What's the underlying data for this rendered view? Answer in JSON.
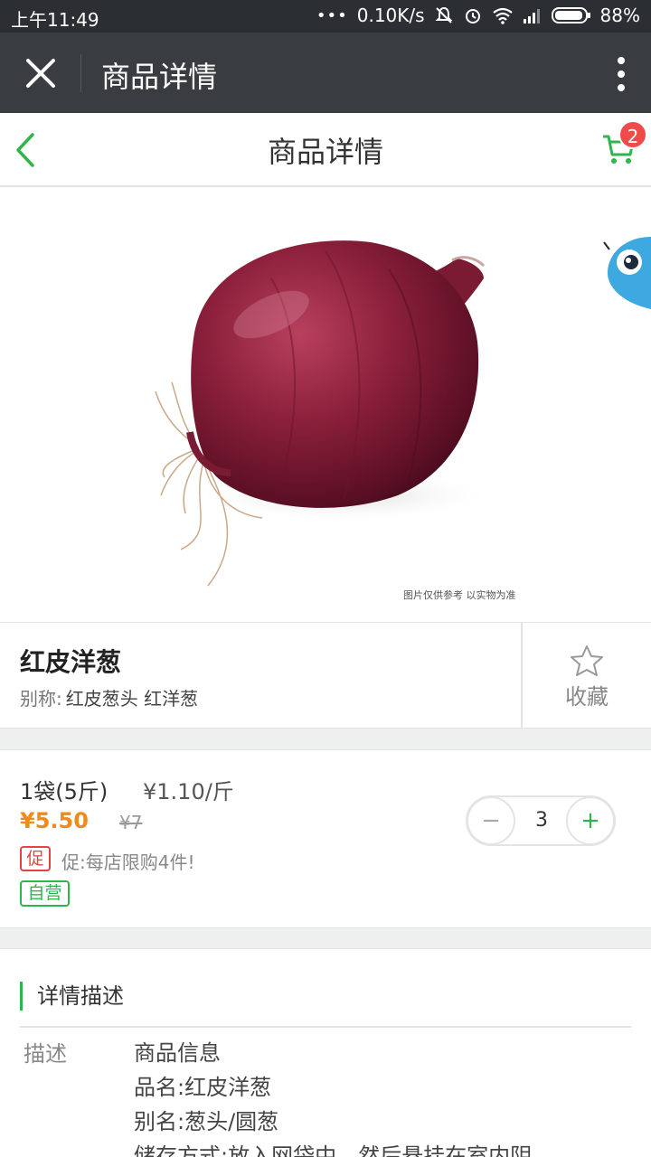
{
  "status_bar": {
    "time": "上午11:49",
    "dots": "•••",
    "speed": "0.10K/s",
    "battery": "88%"
  },
  "webview": {
    "title": "商品详情"
  },
  "header": {
    "title": "商品详情",
    "cart_count": "2"
  },
  "hero": {
    "caption": "图片仅供参考  以实物为准"
  },
  "product": {
    "name": "红皮洋葱",
    "alias_label": "别称:",
    "alias": "红皮葱头 红洋葱",
    "favorite_label": "收藏"
  },
  "pricing": {
    "spec": "1袋(5斤)",
    "unit_price": "¥1.10/斤",
    "price": "¥5.50",
    "original_price": "¥7",
    "promo_tag": "促",
    "promo_text": "促:每店限购4件!",
    "self_tag": "自营",
    "quantity": "3",
    "minus": "−",
    "plus": "+"
  },
  "details": {
    "section_title": "详情描述",
    "label": "描述",
    "lines": [
      "商品信息",
      "品名:红皮洋葱",
      "别名:葱头/圆葱",
      "储存方式:放入网袋中，然后悬挂在室内阴"
    ]
  },
  "colors": {
    "accent_green": "#2fb64a",
    "price_orange": "#f08a1c",
    "promo_red": "#e04545",
    "badge_red": "#f04b4b",
    "titlebar_dark": "#393d41"
  }
}
